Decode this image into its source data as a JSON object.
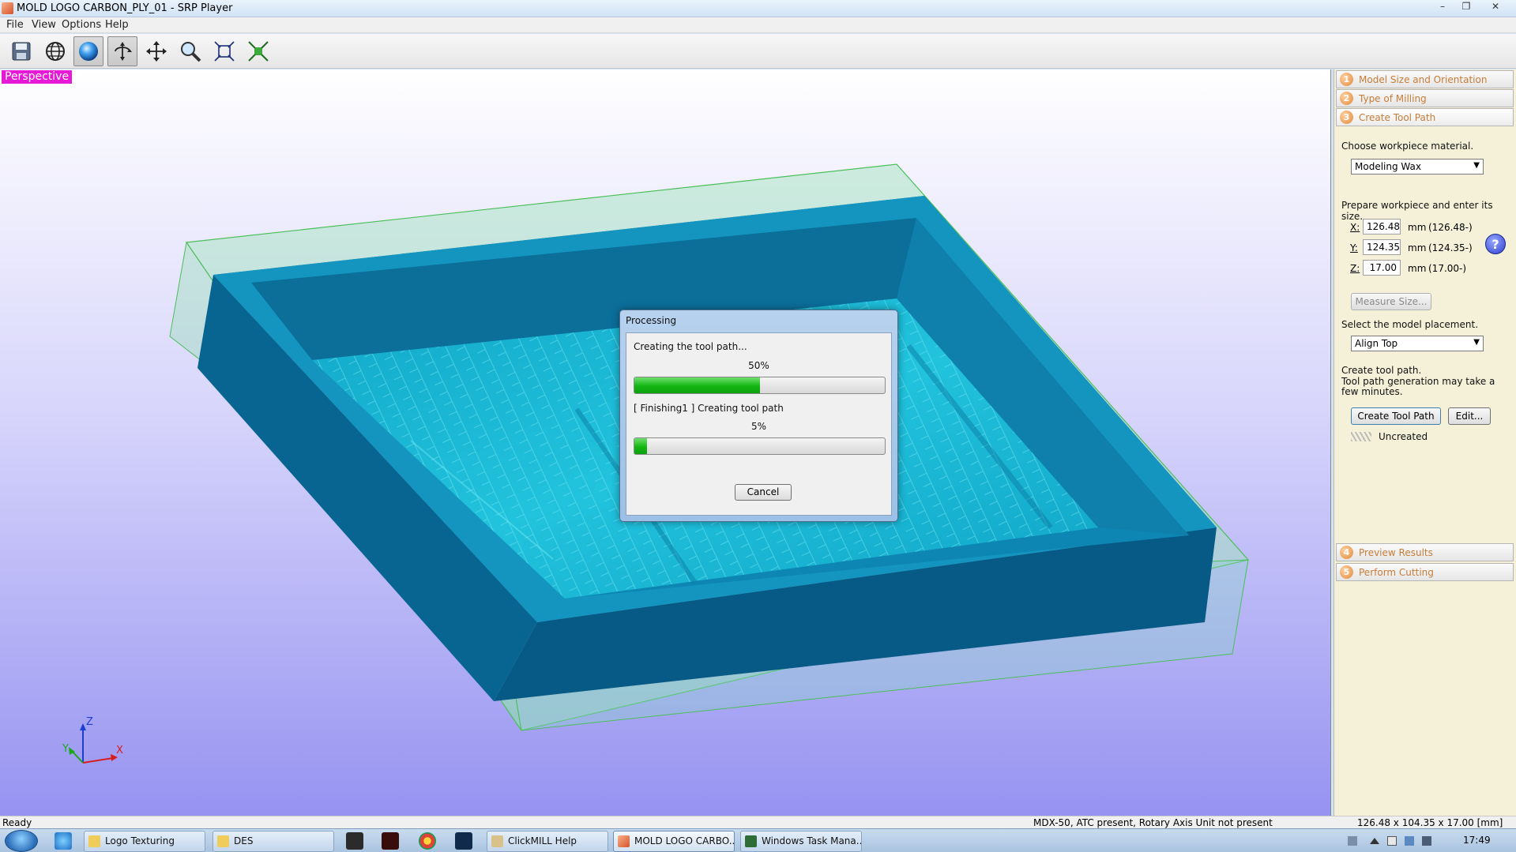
{
  "window": {
    "title": "MOLD LOGO CARBON_PLY_01 - SRP Player",
    "minimize_icon": "minimize-icon",
    "restore_icon": "restore-icon",
    "close_icon": "close-icon"
  },
  "menu": [
    "File",
    "View",
    "Options",
    "Help"
  ],
  "toolbar": {
    "icons": [
      "save-icon",
      "globe-icon",
      "sphere-shading-icon",
      "rotate-view-icon",
      "pan-icon",
      "zoom-icon",
      "fit-view-icon",
      "zoom-extents-icon"
    ]
  },
  "viewport": {
    "view_label": "Perspective",
    "axes": {
      "x": "X",
      "y": "Y",
      "z": "Z"
    }
  },
  "dialog": {
    "title": "Processing",
    "line1": "Creating the tool path...",
    "percent1": "50%",
    "progress1": 50,
    "line2": "[ Finishing1 ] Creating tool path",
    "percent2": "5%",
    "progress2": 5,
    "cancel_label": "Cancel"
  },
  "panel": {
    "steps_top": [
      {
        "num": "1",
        "label": "Model Size and Orientation"
      },
      {
        "num": "2",
        "label": "Type of Milling"
      },
      {
        "num": "3",
        "label": "Create Tool Path"
      }
    ],
    "steps_bottom": [
      {
        "num": "4",
        "label": "Preview Results"
      },
      {
        "num": "5",
        "label": "Perform Cutting"
      }
    ],
    "material_label": "Choose workpiece material.",
    "material_value": "Modeling Wax",
    "size_label": "Prepare workpiece and enter its size.",
    "x_label": "X:",
    "x_value": "126.48",
    "x_unit": "mm",
    "x_range": "(126.48-)",
    "y_label": "Y:",
    "y_value": "124.35",
    "y_unit": "mm",
    "y_range": "(124.35-)",
    "z_label": "Z:",
    "z_value": "17.00",
    "z_unit": "mm",
    "z_range": "(17.00-)",
    "measure_label": "Measure Size...",
    "placement_label": "Select the model placement.",
    "placement_value": "Align Top",
    "create_label": "Create tool path.",
    "create_note": "Tool path generation may take a few minutes.",
    "create_button": "Create Tool Path",
    "edit_button": "Edit...",
    "status": "Uncreated",
    "help_glyph": "?"
  },
  "statusbar": {
    "left": "Ready",
    "machine": "MDX-50, ATC present, Rotary Axis Unit not present",
    "size": "126.48 x 104.35 x 17.00 [mm]"
  },
  "taskbar": {
    "items": [
      {
        "label": "Logo Texturing"
      },
      {
        "label": "DES"
      },
      {
        "label": "ClickMILL Help"
      },
      {
        "label": "MOLD LOGO CARBO..."
      },
      {
        "label": "Windows Task Mana..."
      }
    ],
    "clock": "17:49"
  }
}
